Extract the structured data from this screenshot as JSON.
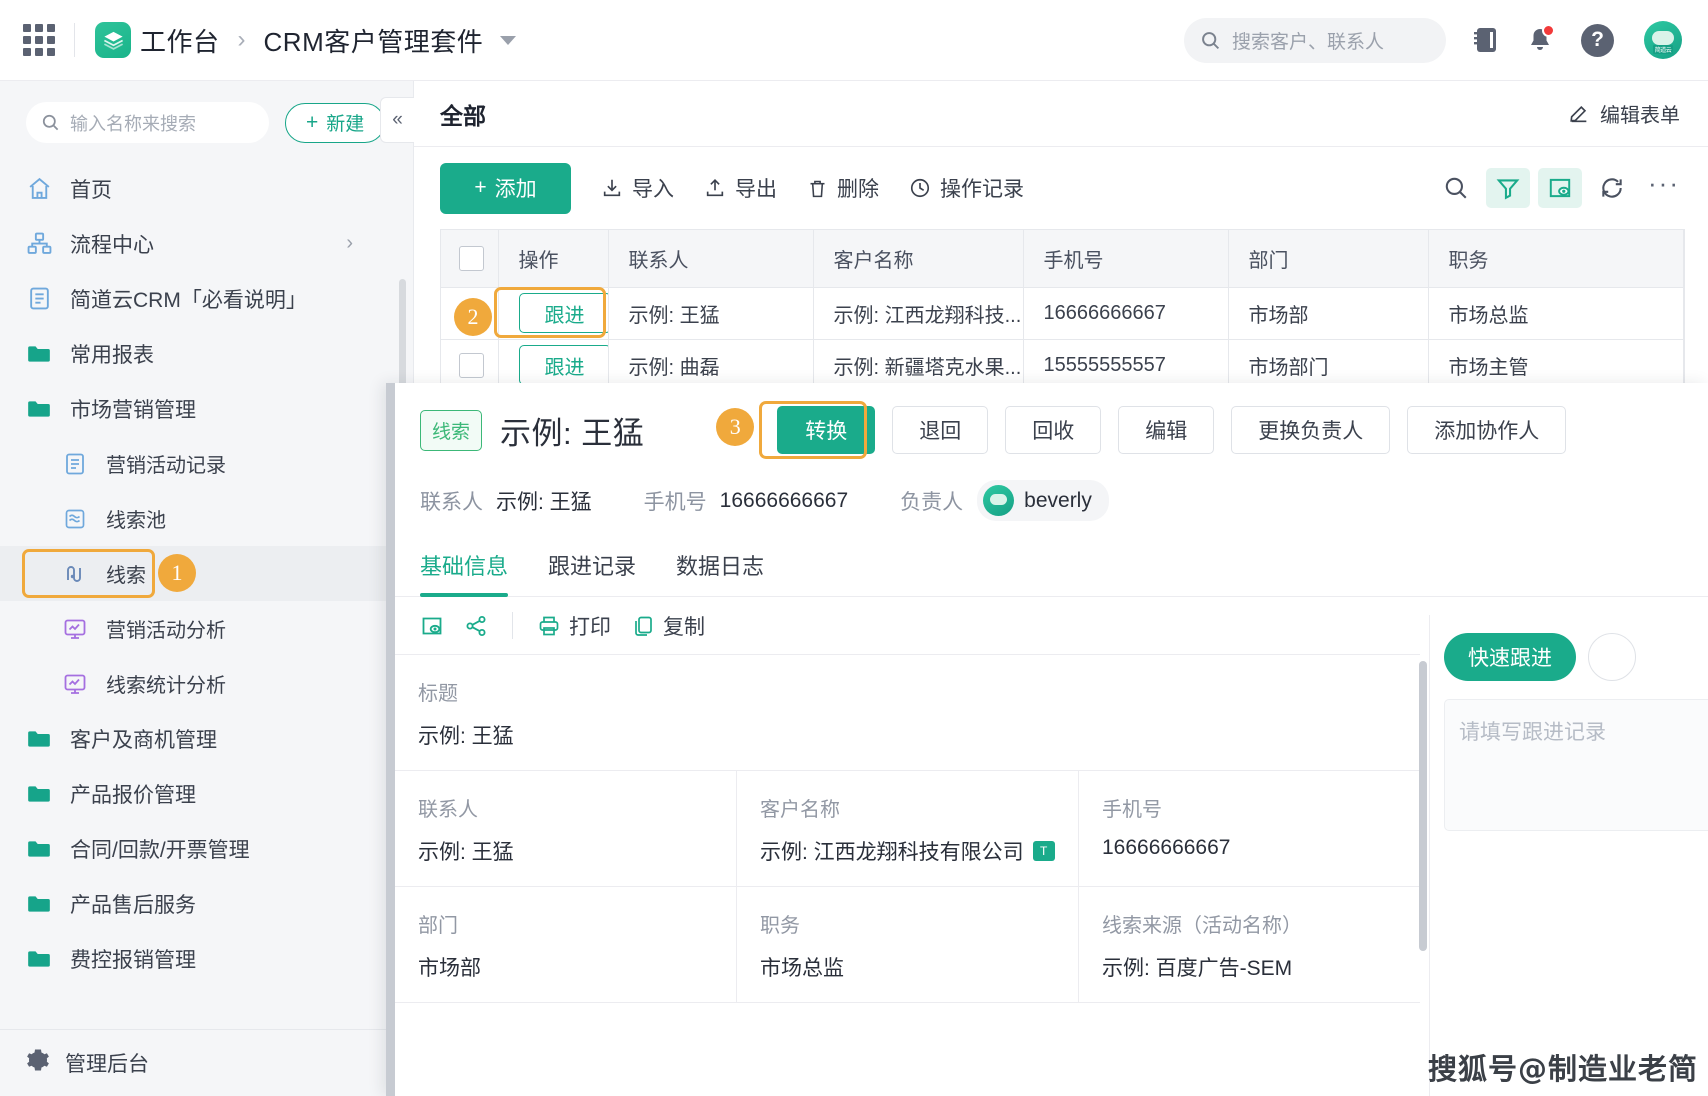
{
  "header": {
    "breadcrumb_home": "工作台",
    "breadcrumb_current": "CRM客户管理套件",
    "search_placeholder": "搜索客户、联系人"
  },
  "sidebar": {
    "search_placeholder": "输入名称来搜索",
    "new_button": "新建",
    "items": [
      {
        "label": "首页",
        "icon": "home-icon",
        "level": "top"
      },
      {
        "label": "流程中心",
        "icon": "flow-icon",
        "level": "top",
        "chevron": "›"
      },
      {
        "label": "简道云CRM「必看说明」",
        "icon": "doc-icon",
        "level": "top"
      },
      {
        "label": "常用报表",
        "icon": "folder-icon",
        "level": "top"
      },
      {
        "label": "市场营销管理",
        "icon": "folder-icon",
        "level": "top"
      },
      {
        "label": "营销活动记录",
        "icon": "doc-icon",
        "level": "sub"
      },
      {
        "label": "线索池",
        "icon": "pool-icon",
        "level": "sub"
      },
      {
        "label": "线索",
        "icon": "lead-icon",
        "level": "sub",
        "active": true,
        "step": "1"
      },
      {
        "label": "营销活动分析",
        "icon": "chart-icon",
        "level": "sub"
      },
      {
        "label": "线索统计分析",
        "icon": "chart-icon",
        "level": "sub"
      },
      {
        "label": "客户及商机管理",
        "icon": "folder-icon",
        "level": "top"
      },
      {
        "label": "产品报价管理",
        "icon": "folder-icon",
        "level": "top"
      },
      {
        "label": "合同/回款/开票管理",
        "icon": "folder-icon",
        "level": "top"
      },
      {
        "label": "产品售后服务",
        "icon": "folder-icon",
        "level": "top"
      },
      {
        "label": "费控报销管理",
        "icon": "folder-icon",
        "level": "top"
      }
    ],
    "admin": "管理后台"
  },
  "main": {
    "view_title": "全部",
    "edit_form": "编辑表单",
    "toolbar": {
      "add": "添加",
      "import": "导入",
      "export": "导出",
      "delete": "删除",
      "log": "操作记录"
    }
  },
  "table": {
    "columns": [
      "操作",
      "联系人",
      "客户名称",
      "手机号",
      "部门",
      "职务"
    ],
    "follow_label": "跟进",
    "rows": [
      {
        "contact": "示例: 王猛",
        "customer": "示例: 江西龙翔科技...",
        "phone": "16666666667",
        "dept": "市场部",
        "position": "市场总监",
        "step": "2"
      },
      {
        "contact": "示例: 曲磊",
        "customer": "示例: 新疆塔克水果...",
        "phone": "15555555557",
        "dept": "市场部门",
        "position": "市场主管"
      }
    ]
  },
  "detail": {
    "tag": "线索",
    "title": "示例: 王猛",
    "step": "3",
    "actions": {
      "convert": "转换",
      "return": "退回",
      "recycle": "回收",
      "edit": "编辑",
      "change_owner": "更换负责人",
      "add_collaborator": "添加协作人"
    },
    "meta": {
      "contact_label": "联系人",
      "contact_value": "示例: 王猛",
      "phone_label": "手机号",
      "phone_value": "16666666667",
      "owner_label": "负责人",
      "owner_name": "beverly"
    },
    "tabs": [
      {
        "label": "基础信息",
        "active": true
      },
      {
        "label": "跟进记录",
        "active": false
      },
      {
        "label": "数据日志",
        "active": false
      }
    ],
    "tools": {
      "print": "打印",
      "copy": "复制"
    },
    "fields": [
      [
        {
          "label": "标题",
          "value": "示例: 王猛",
          "full": true
        }
      ],
      [
        {
          "label": "联系人",
          "value": "示例: 王猛"
        },
        {
          "label": "客户名称",
          "value": "示例: 江西龙翔科技有限公司",
          "badge": "T"
        },
        {
          "label": "手机号",
          "value": "16666666667"
        }
      ],
      [
        {
          "label": "部门",
          "value": "市场部"
        },
        {
          "label": "职务",
          "value": "市场总监"
        },
        {
          "label": "线索来源（活动名称）",
          "value": "示例: 百度广告-SEM"
        }
      ]
    ],
    "right_pane": {
      "quick_follow": "快速跟进",
      "note_placeholder": "请填写跟进记录"
    }
  },
  "watermark": "搜狐号@制造业老简"
}
